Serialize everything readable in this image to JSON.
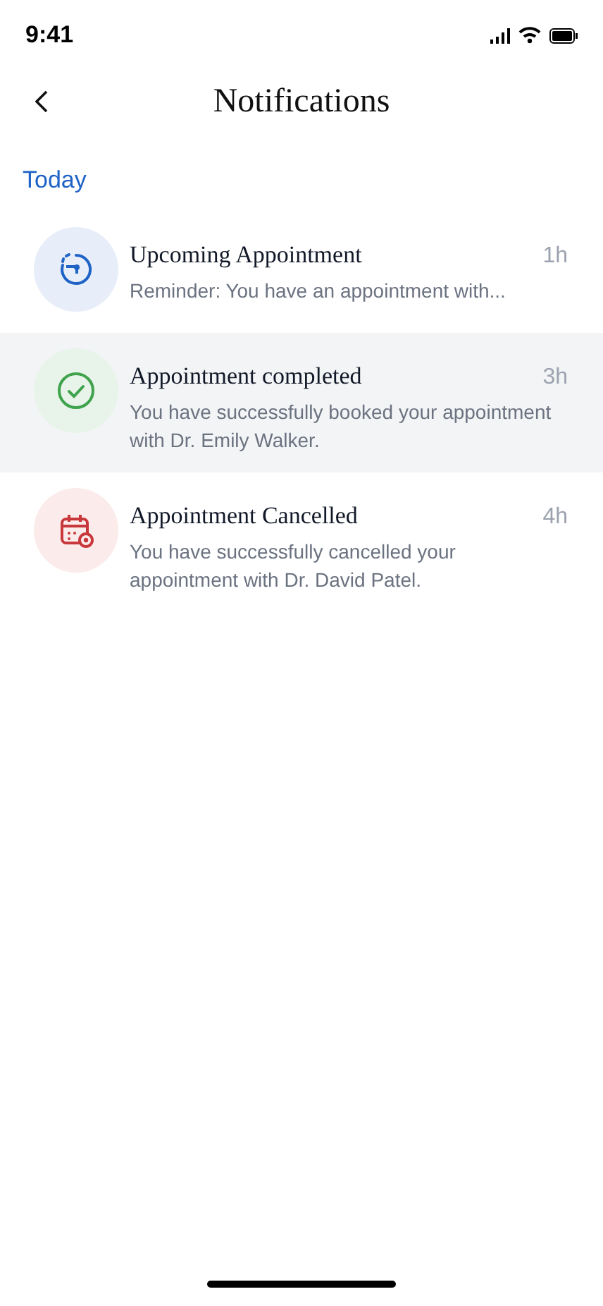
{
  "status_bar": {
    "time": "9:41"
  },
  "header": {
    "title": "Notifications"
  },
  "section": {
    "title": "Today"
  },
  "notifications": [
    {
      "kind": "reminder",
      "title": "Upcoming Appointment",
      "time": "1h",
      "message": "Reminder: You have an appointment with...",
      "highlighted": false
    },
    {
      "kind": "completed",
      "title": "Appointment completed",
      "time": "3h",
      "message": "You have successfully booked your appointment with Dr. Emily Walker.",
      "highlighted": true
    },
    {
      "kind": "cancelled",
      "title": "Appointment Cancelled",
      "time": "4h",
      "message": "You have successfully cancelled your appointment with Dr. David Patel.",
      "highlighted": false
    }
  ]
}
